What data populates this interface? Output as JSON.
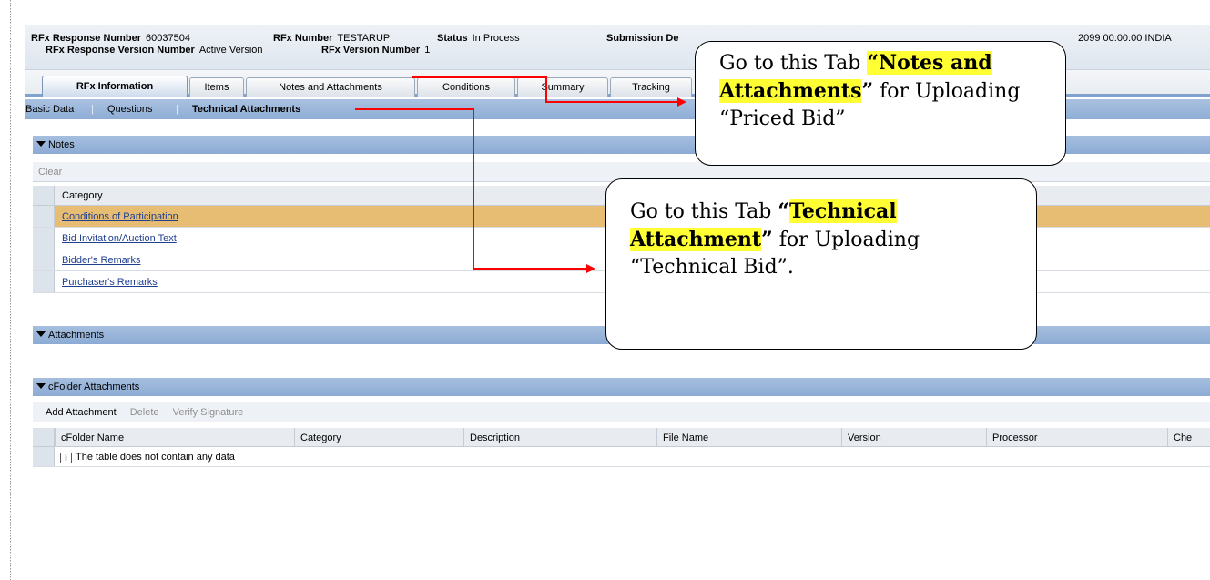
{
  "header": {
    "response_number_label": "RFx Response Number",
    "response_number_value": "60037504",
    "rfx_number_label": "RFx Number",
    "rfx_number_value": "TESTARUP",
    "status_label": "Status",
    "status_value": "In Process",
    "submission_label": "Submission De",
    "date_fragment": "2099 00:00:00 INDIA",
    "response_version_label": "RFx Response Version Number",
    "response_version_value": "Active Version",
    "rfx_version_label": "RFx Version Number",
    "rfx_version_value": "1"
  },
  "tabs": [
    {
      "label": "RFx Information"
    },
    {
      "label": "Items"
    },
    {
      "label": "Notes and Attachments"
    },
    {
      "label": "Conditions"
    },
    {
      "label": "Summary"
    },
    {
      "label": "Tracking"
    }
  ],
  "subnav": {
    "basic_data": "Basic Data",
    "questions": "Questions",
    "technical_attachments": "Technical Attachments",
    "separator": "|"
  },
  "notes": {
    "title": "Notes",
    "clear_label": "Clear",
    "column_category": "Category",
    "rows": [
      {
        "label": "Conditions of Participation"
      },
      {
        "label": "Bid Invitation/Auction Text"
      },
      {
        "label": "Bidder's Remarks"
      },
      {
        "label": "Purchaser's Remarks"
      }
    ]
  },
  "attachments": {
    "title": "Attachments"
  },
  "cfolder": {
    "title": "cFolder Attachments",
    "add_label": "Add Attachment",
    "delete_label": "Delete",
    "verify_label": "Verify Signature",
    "columns": [
      "cFolder Name",
      "Category",
      "Description",
      "File Name",
      "Version",
      "Processor",
      "Che"
    ],
    "empty_message": "The table does not contain any data"
  },
  "callout1": {
    "prefix": "Go to this Tab ",
    "highlight": "“Notes and Attachments",
    "quote_close": "”",
    "suffix": " for Uploading “Priced Bid”"
  },
  "callout2": {
    "prefix": "Go to this Tab ",
    "quote_open": "“",
    "highlight": "Technical Attachment",
    "quote_close": "”",
    "suffix": " for Uploading “Technical Bid”."
  },
  "colors": {
    "selected_row": "#e6bd73",
    "section_header": "#8cabd4",
    "highlight": "#ffff33",
    "arrow": "#ff0000",
    "link": "#1f3f8f"
  }
}
